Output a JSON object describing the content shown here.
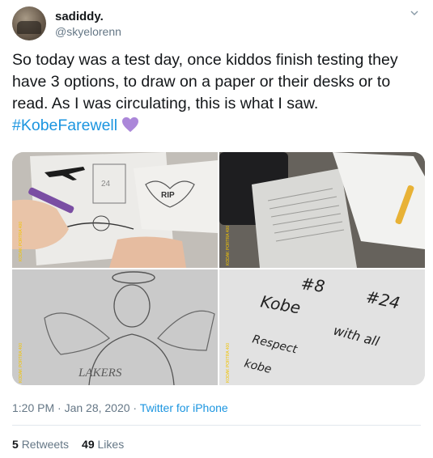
{
  "user": {
    "display_name": "sadiddy.",
    "handle": "@skyelorenn"
  },
  "tweet": {
    "text": "So today was a test day, once kiddos finish testing they have 3 options, to draw on a paper or their desks or to read. As I was circulating, this is what I saw.",
    "hashtag": "#KobeFarewell"
  },
  "icons": {
    "menu": "chevron-down-icon",
    "emoji": "purple-heart-icon"
  },
  "photos": {
    "p1": {
      "rip": "RIP",
      "film": "KODAK PORTRA 400"
    },
    "p2": {
      "film": "KODAK PORTRA 400"
    },
    "p3": {
      "lakers": "LAKERS",
      "film": "KODAK PORTRA 400"
    },
    "p4": {
      "line1": "#8",
      "line2": "Kobe",
      "line3": "#24",
      "line4": "with all",
      "line5": "Respect",
      "line6": "kobe",
      "film": "KODAK PORTRA 400"
    }
  },
  "meta": {
    "time": "1:20 PM · Jan 28, 2020",
    "sep": " · ",
    "source": "Twitter for iPhone"
  },
  "stats": {
    "retweets_count": "5",
    "retweets_label": "Retweets",
    "likes_count": "49",
    "likes_label": "Likes"
  },
  "colors": {
    "link": "#1b95e0",
    "heart": "#ab87d9",
    "secondary": "#657786"
  }
}
